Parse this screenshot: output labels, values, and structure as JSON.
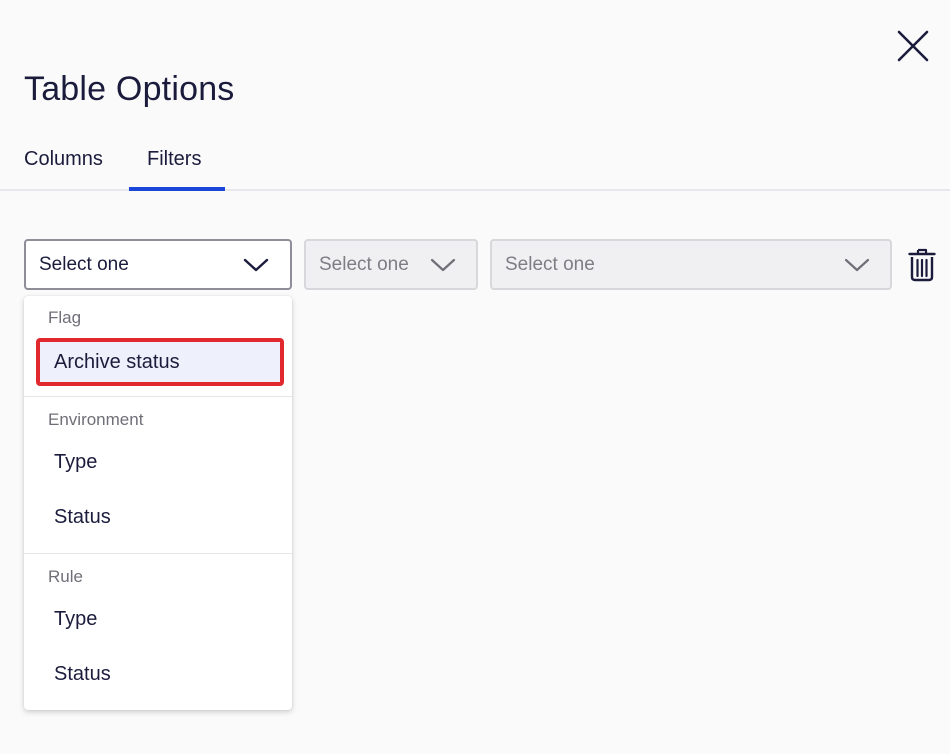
{
  "dialog": {
    "title": "Table Options",
    "close_icon": "close-icon"
  },
  "tabs": [
    {
      "label": "Columns",
      "active": false
    },
    {
      "label": "Filters",
      "active": true
    }
  ],
  "colors": {
    "accent": "#1a47d9",
    "highlight_border": "#e0282e",
    "highlight_bg": "#eef0fb",
    "text": "#1b1c3c"
  },
  "filters": {
    "field_select": {
      "value": "Select one",
      "enabled": true
    },
    "operator_select": {
      "value": "Select one",
      "enabled": false
    },
    "value_select": {
      "value": "Select one",
      "enabled": false
    },
    "delete_icon": "trash-icon"
  },
  "dropdown": {
    "groups": [
      {
        "label": "Flag",
        "options": [
          "Archive status"
        ]
      },
      {
        "label": "Environment",
        "options": [
          "Type",
          "Status"
        ]
      },
      {
        "label": "Rule",
        "options": [
          "Type",
          "Status"
        ]
      }
    ],
    "highlighted_option": "Archive status"
  }
}
